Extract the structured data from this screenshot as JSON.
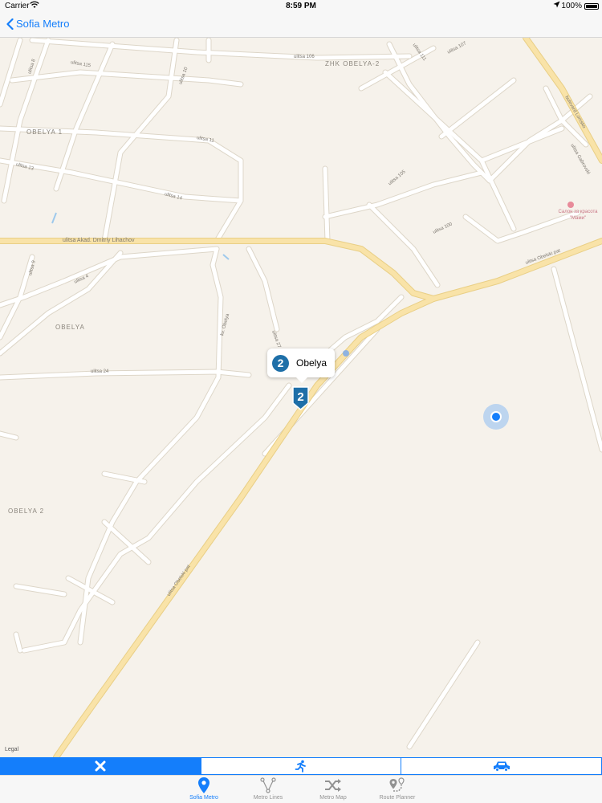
{
  "status_bar": {
    "carrier": "Carrier",
    "time": "8:59 PM",
    "battery": "100%"
  },
  "nav": {
    "back_label": "Sofia Metro"
  },
  "map": {
    "areas": [
      "ZHK OBELYA-2",
      "OBELYA 1",
      "OBELYA",
      "OBELYA 2"
    ],
    "streets": [
      "ulitsa 106",
      "ulitsa 107",
      "ulitsa 111",
      "ulitsa 115",
      "ulitsa 8",
      "ulitsa 10",
      "ulitsa 11",
      "ulitsa 13",
      "ulitsa 14",
      "ulitsa 105",
      "ulitsa 100",
      "ulitsa Akad. Dmitriy Lihachov",
      "ulitsa 9",
      "ulitsa 4",
      "ulitsa 24",
      "ulitsa 27",
      "kv. Obelya",
      "ulitsa Obelski pat",
      "bulevard Lomsko",
      "ulitsa Gabrovski"
    ],
    "poi_label": "Салон за красота \"Мами\"",
    "legal": "Legal",
    "station": {
      "line": "2",
      "name": "Obelya"
    }
  },
  "transport_modes": [
    "close",
    "walk",
    "car"
  ],
  "tabs": [
    {
      "label": "Sofia Metro",
      "icon": "map-pin-icon",
      "active": true
    },
    {
      "label": "Metro Lines",
      "icon": "lines-icon",
      "active": false
    },
    {
      "label": "Metro Map",
      "icon": "shuffle-icon",
      "active": false
    },
    {
      "label": "Route Planner",
      "icon": "route-icon",
      "active": false
    }
  ],
  "colors": {
    "accent": "#147efb",
    "metro_line_2": "#1e6fa8",
    "major_road": "#f7e0a3",
    "minor_road": "#ffffff"
  }
}
